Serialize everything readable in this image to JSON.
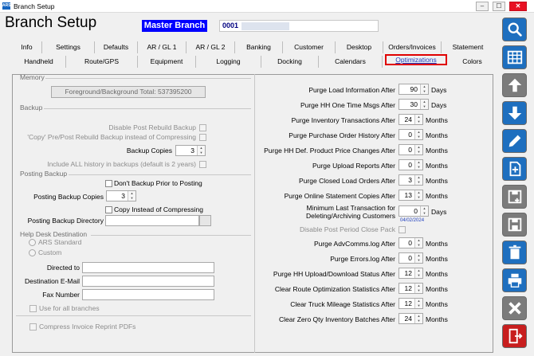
{
  "window": {
    "title": "Branch Setup",
    "min_icon": "minimize-icon",
    "max_icon": "maximize-icon",
    "close_icon": "close-icon"
  },
  "header": {
    "title": "Branch Setup",
    "branch_name": "Master Branch",
    "branch_id": "0001"
  },
  "tabs_row1": [
    "Info",
    "Settings",
    "Defaults",
    "AR / GL 1",
    "AR / GL 2",
    "Banking",
    "Customer",
    "Desktop",
    "Orders/Invoices",
    "Statement"
  ],
  "tabs_row2": [
    "Handheld",
    "Route/GPS",
    "Equipment",
    "Logging",
    "Docking",
    "Calendars",
    "Optimizations",
    "Colors"
  ],
  "active_tab": "Optimizations",
  "memory": {
    "group": "Memory",
    "button": "Foreground/Background Total: 537395200"
  },
  "backup": {
    "group": "Backup",
    "disable_post_rebuild": "Disable Post Rebuild Backup",
    "copy_pre_post": "'Copy' Pre/Post Rebuild Backup instead of Compressing",
    "copies_label": "Backup Copies",
    "copies_value": "3",
    "include_all_history": "Include ALL history in backups (default is 2 years)"
  },
  "posting_backup": {
    "group": "Posting Backup",
    "dont_backup": "Don't Backup Prior to Posting",
    "copies_label": "Posting Backup Copies",
    "copies_value": "3",
    "copy_instead": "Copy Instead of Compressing",
    "directory_label": "Posting Backup Directory",
    "directory_value": ""
  },
  "help_desk": {
    "group": "Help Desk Destination",
    "ars_standard": "ARS Standard",
    "custom": "Custom",
    "directed_to": "Directed to",
    "destination_email": "Destination E-Mail",
    "fax_number": "Fax Number",
    "use_all_branches": "Use for all branches"
  },
  "compress_invoice": "Compress Invoice Reprint PDFs",
  "purge_rows": [
    {
      "label": "Purge Load Information After",
      "value": "90",
      "unit": "Days"
    },
    {
      "label": "Purge HH One Time Msgs After",
      "value": "30",
      "unit": "Days"
    },
    {
      "label": "Purge Inventory Transactions After",
      "value": "24",
      "unit": "Months"
    },
    {
      "label": "Purge Purchase Order History After",
      "value": "0",
      "unit": "Months"
    },
    {
      "label": "Purge HH Def. Product Price Changes After",
      "value": "0",
      "unit": "Months"
    },
    {
      "label": "Purge Upload Reports After",
      "value": "0",
      "unit": "Months"
    },
    {
      "label": "Purge Closed Load Orders After",
      "value": "3",
      "unit": "Months"
    },
    {
      "label": "Purge Online Statement Copies After",
      "value": "13",
      "unit": "Months"
    }
  ],
  "min_transaction": {
    "label_line1": "Minimum Last Transaction for",
    "label_line2": "Deleting/Archiving Customers",
    "value": "0",
    "unit": "Days",
    "date": "04/02/2024"
  },
  "disable_post_period": "Disable Post Period Close Pack",
  "purge_rows2": [
    {
      "label": "Purge AdvComms.log After",
      "value": "0",
      "unit": "Months"
    },
    {
      "label": "Purge Errors.log After",
      "value": "0",
      "unit": "Months"
    },
    {
      "label": "Purge HH Upload/Download Status After",
      "value": "12",
      "unit": "Months"
    },
    {
      "label": "Clear Route Optimization Statistics After",
      "value": "12",
      "unit": "Months"
    },
    {
      "label": "Clear Truck Mileage Statistics After",
      "value": "12",
      "unit": "Months"
    },
    {
      "label": "Clear Zero Qty Inventory Batches After",
      "value": "24",
      "unit": "Months"
    }
  ],
  "side_buttons": [
    "search-icon",
    "grid-icon",
    "arrow-up-icon",
    "arrow-down-icon",
    "edit-pencil-icon",
    "new-document-icon",
    "save-as-icon",
    "save-icon",
    "delete-trash-icon",
    "print-icon",
    "cancel-x-icon",
    "exit-door-icon"
  ],
  "colors": {
    "branch_label_bg": "#0000ff",
    "active_tab_border": "#e00000",
    "side_blue": "#1e6fbf",
    "side_gray": "#7b7b7b",
    "side_red": "#c81e1e"
  }
}
